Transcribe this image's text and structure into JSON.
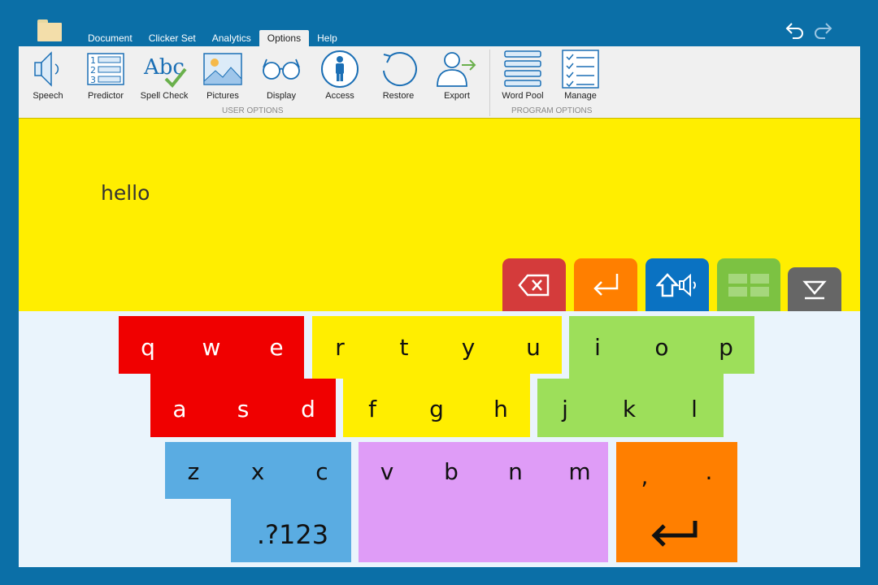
{
  "top": {
    "tabs": [
      {
        "label": "Document",
        "active": false
      },
      {
        "label": "Clicker Set",
        "active": false
      },
      {
        "label": "Analytics",
        "active": false
      },
      {
        "label": "Options",
        "active": true
      },
      {
        "label": "Help",
        "active": false
      }
    ],
    "icons": [
      "folder-icon",
      "undo-icon",
      "redo-icon"
    ]
  },
  "ribbon": {
    "user_buttons": [
      {
        "label": "Speech",
        "icon": "speaker-icon"
      },
      {
        "label": "Predictor",
        "icon": "numbered-list-icon"
      },
      {
        "label": "Spell Check",
        "icon": "spell-check-icon"
      },
      {
        "label": "Pictures",
        "icon": "picture-icon"
      },
      {
        "label": "Display",
        "icon": "glasses-icon"
      },
      {
        "label": "Access",
        "icon": "accessibility-icon"
      },
      {
        "label": "Restore",
        "icon": "restore-icon"
      },
      {
        "label": "Export",
        "icon": "export-user-icon"
      }
    ],
    "user_group_label": "USER OPTIONS",
    "program_buttons": [
      {
        "label": "Word Pool",
        "icon": "word-pool-icon"
      },
      {
        "label": "Manage",
        "icon": "checklist-icon"
      }
    ],
    "program_group_label": "PROGRAM OPTIONS"
  },
  "document": {
    "text": "hello",
    "actions": [
      {
        "name": "backspace-button",
        "icon": "backspace-icon",
        "color": "#d43b3b"
      },
      {
        "name": "return-button",
        "icon": "return-arrow-icon",
        "color": "#ff7f00"
      },
      {
        "name": "speak-button",
        "icon": "shift-speak-icon",
        "color": "#0a72c2"
      },
      {
        "name": "grid-button",
        "icon": "grid-icon",
        "color": "#7cc242"
      },
      {
        "name": "hide-keyboard-button",
        "icon": "eject-icon",
        "color": "#666666"
      }
    ]
  },
  "keyboard": {
    "colors": {
      "red": "#f00000",
      "yellow": "#ffee00",
      "green": "#9ddf5a",
      "blue": "#5aace2",
      "purple": "#df9cf7",
      "orange": "#ff7f00"
    },
    "row1_red": [
      "q",
      "w",
      "e"
    ],
    "row1_yellow": [
      "r",
      "t",
      "y",
      "u"
    ],
    "row1_green": [
      "i",
      "o",
      "p"
    ],
    "row2_red": [
      "a",
      "s",
      "d"
    ],
    "row2_yellow": [
      "f",
      "g",
      "h"
    ],
    "row2_green": [
      "j",
      "k",
      "l"
    ],
    "row3_blue": [
      "z",
      "x",
      "c"
    ],
    "row3_purple": [
      "v",
      "b",
      "n",
      "m"
    ],
    "punct": [
      ",",
      "."
    ],
    "numbers_label": ".?123"
  }
}
